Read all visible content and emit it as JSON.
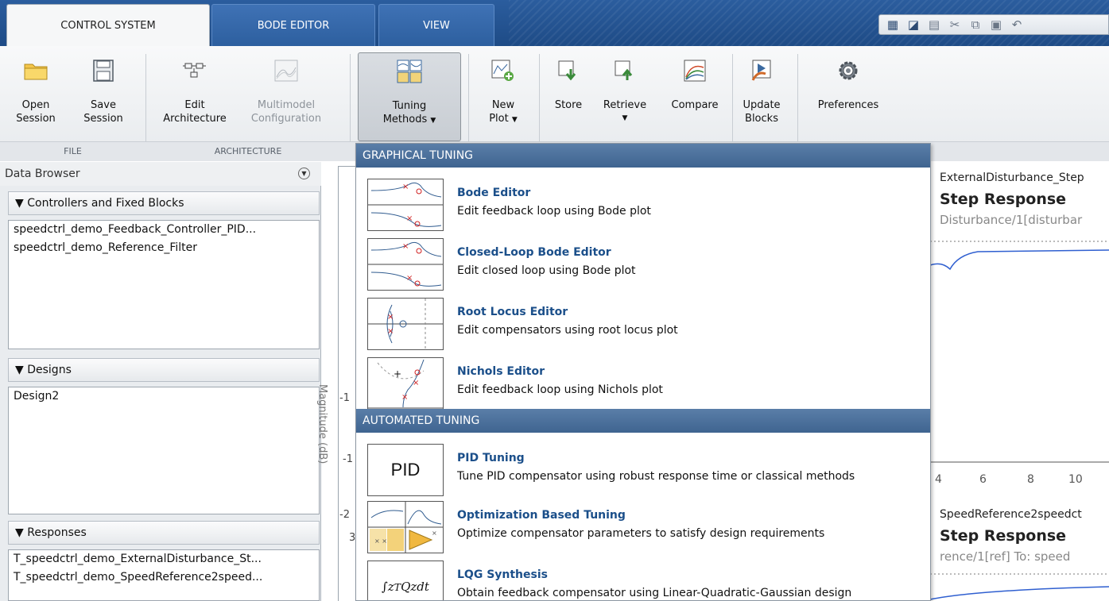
{
  "tabs": [
    {
      "label": "CONTROL SYSTEM",
      "active": true
    },
    {
      "label": "BODE EDITOR",
      "active": false
    },
    {
      "label": "VIEW",
      "active": false
    }
  ],
  "ribbon": {
    "open_session": [
      "Open",
      "Session"
    ],
    "save_session": [
      "Save",
      "Session"
    ],
    "edit_architecture": [
      "Edit",
      "Architecture"
    ],
    "multimodel_configuration": [
      "Multimodel",
      "Configuration"
    ],
    "tuning_methods": [
      "Tuning",
      "Methods"
    ],
    "new_plot": [
      "New",
      "Plot"
    ],
    "store": "Store",
    "retrieve": "Retrieve",
    "compare": "Compare",
    "update_blocks": [
      "Update",
      "Blocks"
    ],
    "preferences": "Preferences",
    "group_file": "FILE",
    "group_architecture": "ARCHITECTURE"
  },
  "data_browser": {
    "title": "Data Browser",
    "controllers": {
      "header": "Controllers and Fixed Blocks",
      "items": [
        "speedctrl_demo_Feedback_Controller_PID...",
        "speedctrl_demo_Reference_Filter"
      ]
    },
    "designs": {
      "header": "Designs",
      "items": [
        "Design2"
      ]
    },
    "responses": {
      "header": "Responses",
      "items": [
        "T_speedctrl_demo_ExternalDisturbance_St...",
        "T_speedctrl_demo_SpeedReference2speed..."
      ]
    }
  },
  "plot": {
    "ylabel": "Magnitude (dB)",
    "ticks": [
      "-1",
      "-1",
      "-2",
      "3"
    ]
  },
  "right_plot": {
    "top_title": "ExternalDisturbance_Step",
    "top_bold": "Step Response",
    "top_sub": "Disturbance/1[disturbar",
    "xticks": [
      "4",
      "6",
      "8",
      "10"
    ],
    "bottom_title": "SpeedReference2speedct",
    "bottom_bold": "Step Response",
    "bottom_sub": "rence/1[ref]  To: speed"
  },
  "menu": {
    "graphical_header": "GRAPHICAL TUNING",
    "automated_header": "AUTOMATED TUNING",
    "graphical": [
      {
        "title": "Bode Editor",
        "desc": "Edit feedback loop using Bode plot"
      },
      {
        "title": "Closed-Loop Bode Editor",
        "desc": "Edit closed loop using Bode plot"
      },
      {
        "title": "Root Locus Editor",
        "desc": "Edit compensators using root locus plot"
      },
      {
        "title": "Nichols Editor",
        "desc": "Edit feedback loop using Nichols plot"
      }
    ],
    "automated": [
      {
        "title": "PID Tuning",
        "desc": "Tune PID compensator using robust response time or classical methods",
        "thumb": "PID"
      },
      {
        "title": "Optimization Based Tuning",
        "desc": "Optimize compensator parameters to satisfy design requirements"
      },
      {
        "title": "LQG Synthesis",
        "desc": "Obtain feedback compensator using Linear-Quadratic-Gaussian design"
      }
    ]
  },
  "colors": {
    "tab_bar": "#2b5d9e",
    "menu_header": "#4a6f9b",
    "link_blue": "#1b4f8a"
  }
}
